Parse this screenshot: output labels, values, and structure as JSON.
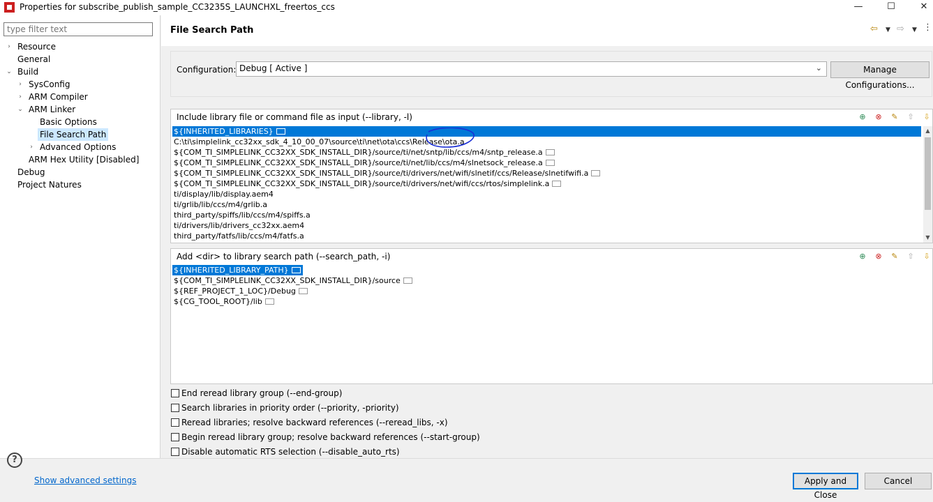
{
  "window": {
    "title": "Properties for subscribe_publish_sample_CC3235S_LAUNCHXL_freertos_ccs",
    "min": "—",
    "max": "☐",
    "close": "✕"
  },
  "filter": {
    "placeholder": "type filter text"
  },
  "tree": [
    {
      "label": "Resource",
      "arrow": "›"
    },
    {
      "label": "General",
      "arrow": ""
    },
    {
      "label": "Build",
      "arrow": "⌄"
    },
    {
      "label": "SysConfig",
      "arrow": "›"
    },
    {
      "label": "ARM Compiler",
      "arrow": "›"
    },
    {
      "label": "ARM Linker",
      "arrow": "⌄"
    },
    {
      "label": "Basic Options",
      "arrow": ""
    },
    {
      "label": "File Search Path",
      "arrow": ""
    },
    {
      "label": "Advanced Options",
      "arrow": "›"
    },
    {
      "label": "ARM Hex Utility  [Disabled]",
      "arrow": ""
    },
    {
      "label": "Debug",
      "arrow": ""
    },
    {
      "label": "Project Natures",
      "arrow": ""
    }
  ],
  "page": {
    "title": "File Search Path"
  },
  "config": {
    "label": "Configuration:",
    "value": "Debug  [ Active ]",
    "manage": "Manage Configurations..."
  },
  "include": {
    "title": "Include library file or command file as input (--library, -l)",
    "rows": [
      "${INHERITED_LIBRARIES}",
      "C:\\ti\\simplelink_cc32xx_sdk_4_10_00_07\\source\\ti\\net\\ota\\ccs\\Release\\ota.a",
      "${COM_TI_SIMPLELINK_CC32XX_SDK_INSTALL_DIR}/source/ti/net/sntp/lib/ccs/m4/sntp_release.a",
      "${COM_TI_SIMPLELINK_CC32XX_SDK_INSTALL_DIR}/source/ti/net/lib/ccs/m4/slnetsock_release.a",
      "${COM_TI_SIMPLELINK_CC32XX_SDK_INSTALL_DIR}/source/ti/drivers/net/wifi/slnetif/ccs/Release/slnetifwifi.a",
      "${COM_TI_SIMPLELINK_CC32XX_SDK_INSTALL_DIR}/source/ti/drivers/net/wifi/ccs/rtos/simplelink.a",
      "ti/display/lib/display.aem4",
      "ti/grlib/lib/ccs/m4/grlib.a",
      "third_party/spiffs/lib/ccs/m4/spiffs.a",
      "ti/drivers/lib/drivers_cc32xx.aem4",
      "third_party/fatfs/lib/ccs/m4/fatfs.a"
    ]
  },
  "search": {
    "title": "Add <dir> to library search path (--search_path, -i)",
    "rows": [
      "${INHERITED_LIBRARY_PATH}",
      "${COM_TI_SIMPLELINK_CC32XX_SDK_INSTALL_DIR}/source",
      "${REF_PROJECT_1_LOC}/Debug",
      "${CG_TOOL_ROOT}/lib"
    ]
  },
  "checkboxes": [
    "End reread library group (--end-group)",
    "Search libraries in priority order (--priority, -priority)",
    "Reread libraries; resolve backward references (--reread_libs, -x)",
    "Begin reread library group; resolve backward references (--start-group)",
    "Disable automatic RTS selection (--disable_auto_rts)"
  ],
  "bottom": {
    "help": "?",
    "advanced_link": "Show advanced settings",
    "apply": "Apply and Close",
    "cancel": "Cancel"
  }
}
